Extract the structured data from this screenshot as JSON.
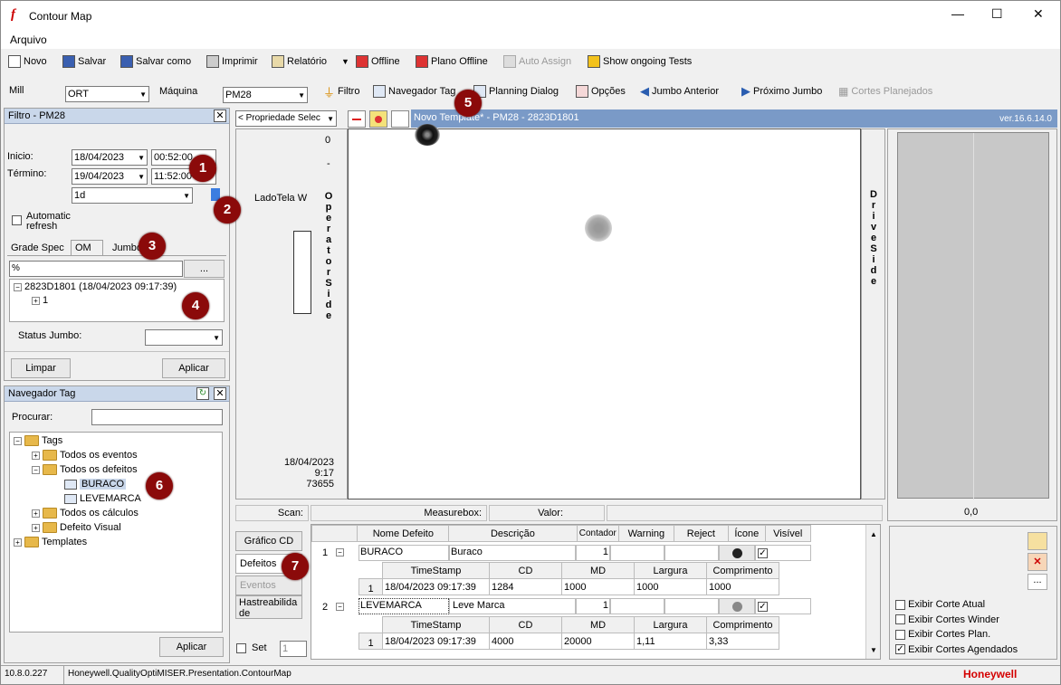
{
  "window": {
    "title": "Contour Map",
    "minimize": "—",
    "maximize": "☐",
    "close": "✕"
  },
  "menu": {
    "file": "Arquivo"
  },
  "toolbar1": {
    "new": "Novo",
    "save": "Salvar",
    "save_as": "Salvar como",
    "print": "Imprimir",
    "report": "Relatório",
    "offline": "Offline",
    "plan_offline": "Plano Offline",
    "auto_assign": "Auto Assign",
    "show_tests": "Show ongoing Tests"
  },
  "toolbar2": {
    "mill_label": "Mill",
    "mill_value": "ORT",
    "machine_label": "Máquina",
    "machine_value": "PM28",
    "filter": "Filtro",
    "tag_nav": "Navegador Tag",
    "planning": "Planning Dialog",
    "options": "Opções",
    "prev_jumbo": "Jumbo Anterior",
    "next_jumbo": "Próximo Jumbo",
    "planned_cuts": "Cortes Planejados"
  },
  "filter_panel": {
    "title": "Filtro - PM28",
    "start_label": "Inicio:",
    "start_date": "18/04/2023",
    "start_time": "00:52:00",
    "end_label": "Término:",
    "end_date": "19/04/2023",
    "end_time": "11:52:00",
    "period": "1d",
    "auto_refresh": "Automatic refresh",
    "tabs": [
      "Grade Spec",
      "OM",
      "Jumbo"
    ],
    "search_value": "%",
    "browse": "...",
    "tree_root": "2823D1801 (18/04/2023 09:17:39)",
    "tree_child": "1",
    "status_label": "Status Jumbo:",
    "clear": "Limpar",
    "apply": "Aplicar"
  },
  "tag_panel": {
    "title": "Navegador Tag",
    "search_label": "Procurar:",
    "nodes": [
      "Tags",
      "Todos os eventos",
      "Todos os defeitos",
      "BURACO",
      "LEVEMARCA",
      "Todos os cálculos",
      "Defeito Visual",
      "Templates"
    ],
    "apply": "Aplicar"
  },
  "map": {
    "property_select": "< Propriedade Selec",
    "template_title": "Novo Template* - PM28 - 2823D1801",
    "version": "ver.16.6.14.0",
    "top_value": "0",
    "dash": "-",
    "side_label": "LadoTela W",
    "operator_side": "OperatorSide",
    "drive_side": "DriveSide",
    "date": "18/04/2023",
    "time": "9:17",
    "bottom_value": "73655",
    "right_value": "0,0"
  },
  "scan_bar": {
    "scan": "Scan:",
    "measurebox": "Measurebox:",
    "value": "Valor:"
  },
  "side_buttons": [
    "Gráfico CD",
    "Defeitos",
    "Eventos",
    "Hastreabilidade"
  ],
  "set_label": "Set",
  "set_value": "1",
  "defects": {
    "headers": [
      "Nome Defeito",
      "Descrição",
      "Contador",
      "Warning",
      "Reject",
      "Ícone",
      "Visível"
    ],
    "sub_headers": [
      "TimeStamp",
      "CD",
      "MD",
      "Largura",
      "Comprimento"
    ],
    "rows": [
      {
        "num": "1",
        "name": "BURACO",
        "desc": "Buraco",
        "count": "1",
        "sub": {
          "ts": "18/04/2023 09:17:39",
          "cd": "1284",
          "md": "1000",
          "w": "1000",
          "l": "1000"
        }
      },
      {
        "num": "2",
        "name": "LEVEMARCA",
        "desc": "Leve Marca",
        "count": "1",
        "sub": {
          "ts": "18/04/2023 09:17:39",
          "cd": "4000",
          "md": "20000",
          "w": "1,11",
          "l": "3,33"
        }
      }
    ]
  },
  "cut_options": [
    "Exibir Corte Atual",
    "Exibir Cortes Winder",
    "Exibir Cortes Plan.",
    "Exibir Cortes Agendados"
  ],
  "status": {
    "version": "10.8.0.227",
    "module": "Honeywell.QualityOptiMISER.Presentation.ContourMap",
    "brand": "Honeywell"
  },
  "callouts": [
    "1",
    "2",
    "3",
    "4",
    "5",
    "6",
    "7"
  ]
}
